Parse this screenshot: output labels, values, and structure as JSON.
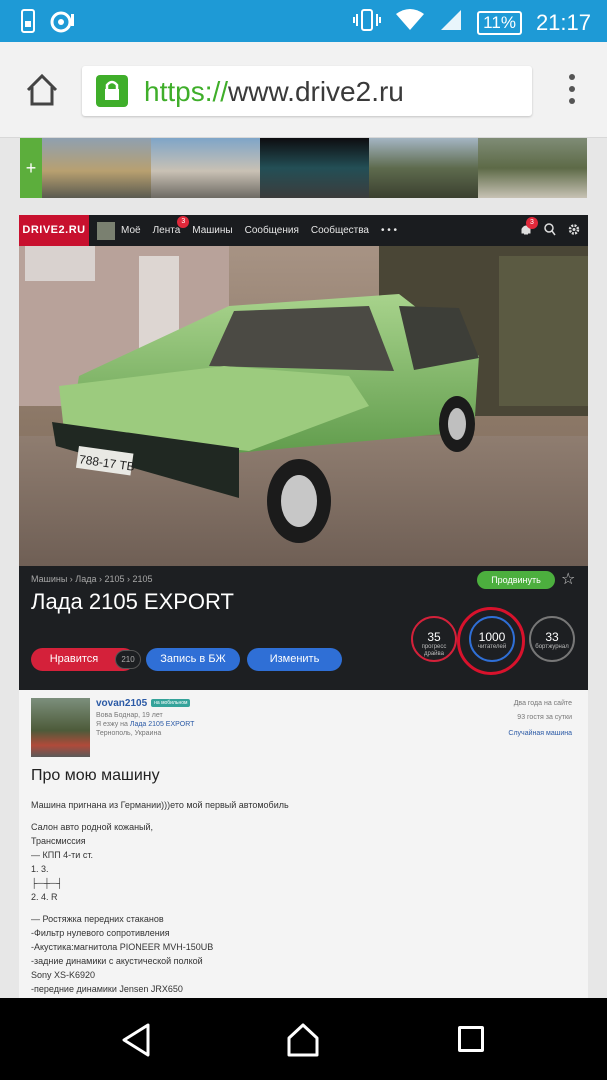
{
  "status": {
    "battery": "11%",
    "time": "21:17"
  },
  "browser": {
    "url_scheme": "https://",
    "url_host": "www.drive2.ru"
  },
  "strip": {
    "plus": "+"
  },
  "nav": {
    "logo": "DRIVE2.RU",
    "items": [
      {
        "label": "Моё"
      },
      {
        "label": "Лента",
        "badge": "3"
      },
      {
        "label": "Машины"
      },
      {
        "label": "Сообщения"
      },
      {
        "label": "Сообщества"
      },
      {
        "label": "• • •"
      }
    ],
    "notif_badge": "3"
  },
  "car": {
    "breadcrumb": "Машины › Лада › 2105 › 2105",
    "promote": "Продвинуть",
    "title": "Лада 2105 EXPORT",
    "plate": "788-17 ТВ",
    "like_label": "Нравится",
    "like_count": "210",
    "bz_label": "Запись в БЖ",
    "edit_label": "Изменить",
    "stats": [
      {
        "num": "35",
        "label": "прогресс драйва"
      },
      {
        "num": "1000",
        "label": "читателей"
      },
      {
        "num": "33",
        "label": "бортжурнал"
      }
    ]
  },
  "profile": {
    "name": "vovan2105",
    "mobile_badge": "на мобильном",
    "fullname": "Вова Боднар, 19 лет",
    "drive_prefix": "Я езжу на ",
    "drive_car": "Лада 2105 EXPORT",
    "location": "Тернополь, Украина",
    "since": "Два года на сайте",
    "guests": "93 гостя за сутки",
    "random": "Случайная машина"
  },
  "article": {
    "heading": "Про мою машину",
    "p1": "Машина пригнана из Германии)))ето мой первый автомобиль",
    "p2": [
      "Салон авто родной кожаный,",
      "Трансмиссия",
      "— КПП 4-ти ст.",
      "1. 3.",
      "├─┼─┤",
      "2. 4. R"
    ],
    "p3": [
      "— Ростяжка передних стаканов",
      "-Фильтр нулевого сопротивления",
      "-Акустика:магнитола PIONEER MVH-150UB",
      "-задние динамики с акустической полкой",
      "Sony XS-K6920",
      "-передние динамики Jensen JRX650"
    ]
  }
}
